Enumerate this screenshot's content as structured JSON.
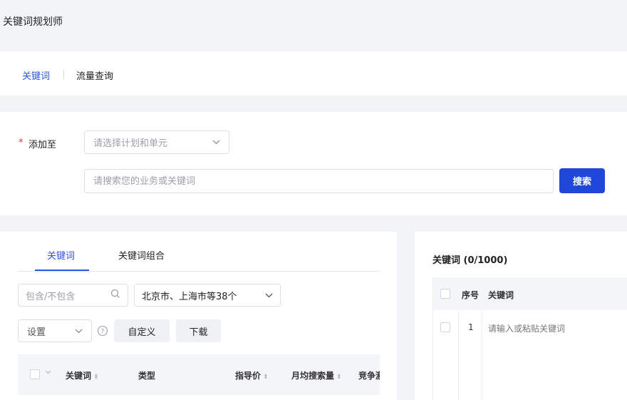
{
  "app": {
    "title": "关键词规划师"
  },
  "top_tabs": [
    {
      "label": "关键词",
      "active": true
    },
    {
      "label": "流量查询",
      "active": false
    }
  ],
  "search_form": {
    "required_mark": "*",
    "add_to_label": "添加至",
    "plan_select_placeholder": "请选择计划和单元",
    "keyword_input_placeholder": "请搜索您的业务或关键词",
    "search_button": "搜索"
  },
  "left_panel": {
    "tabs": [
      {
        "label": "关键词",
        "active": true
      },
      {
        "label": "关键词组合",
        "active": false
      }
    ],
    "filter_placeholder": "包含/不包含",
    "region_value": "北京市、上海市等38个",
    "settings_value": "设置",
    "custom_button": "自定义",
    "download_button": "下载",
    "table_headers": [
      "关键词",
      "类型",
      "指导价",
      "月均搜索量",
      "竞争激"
    ]
  },
  "right_panel": {
    "title": "关键词 (0/1000)",
    "headers": {
      "index": "序号",
      "keyword": "关键词"
    },
    "rows": [
      {
        "index": "1",
        "placeholder": "请输入或粘贴关键词"
      }
    ]
  },
  "colors": {
    "accent": "#2a55e5",
    "primary_button": "#1f48d9",
    "required": "#e2322d",
    "background": "#f3f4f8"
  }
}
